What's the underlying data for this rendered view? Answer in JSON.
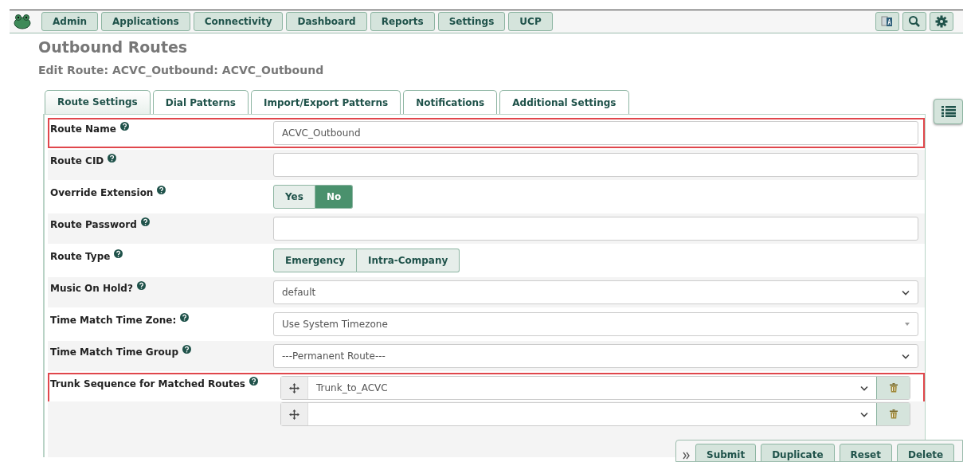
{
  "nav": {
    "items": [
      {
        "label": "Admin"
      },
      {
        "label": "Applications"
      },
      {
        "label": "Connectivity"
      },
      {
        "label": "Dashboard"
      },
      {
        "label": "Reports"
      },
      {
        "label": "Settings"
      },
      {
        "label": "UCP"
      }
    ]
  },
  "page": {
    "title": "Outbound Routes",
    "subtitle": "Edit Route: ACVC_Outbound: ACVC_Outbound"
  },
  "tabs": [
    {
      "label": "Route Settings",
      "selected": true
    },
    {
      "label": "Dial Patterns",
      "selected": false
    },
    {
      "label": "Import/Export Patterns",
      "selected": false
    },
    {
      "label": "Notifications",
      "selected": false
    },
    {
      "label": "Additional Settings",
      "selected": false
    }
  ],
  "fields": [
    {
      "kind": "text",
      "label": "Route Name",
      "value": "ACVC_Outbound",
      "highlighted": true
    },
    {
      "kind": "text",
      "label": "Route CID",
      "highlighted": false
    },
    {
      "kind": "toggle",
      "label": "Override Extension",
      "options": [
        {
          "label": "Yes",
          "selected": false
        },
        {
          "label": "No",
          "selected": true
        }
      ],
      "highlighted": false
    },
    {
      "kind": "text",
      "label": "Route Password",
      "highlighted": false
    },
    {
      "kind": "toggle",
      "label": "Route Type",
      "options": [
        {
          "label": "Emergency",
          "selected": false
        },
        {
          "label": "Intra-Company",
          "selected": false
        }
      ],
      "highlighted": false
    },
    {
      "kind": "select",
      "label": "Music On Hold?",
      "value": "default",
      "highlighted": false
    },
    {
      "kind": "combo",
      "label": "Time Match Time Zone:",
      "value": "Use System Timezone",
      "highlighted": false
    },
    {
      "kind": "select",
      "label": "Time Match Time Group",
      "value": "---Permanent Route---",
      "highlighted": false
    },
    {
      "kind": "trunks",
      "label": "Trunk Sequence for Matched Routes",
      "highlighted": true,
      "trunks": [
        {
          "kind": "filled",
          "value": "Trunk_to_ACVC"
        },
        {
          "kind": "blank"
        }
      ]
    }
  ],
  "actions": [
    {
      "label": "Submit"
    },
    {
      "label": "Duplicate"
    },
    {
      "label": "Reset"
    },
    {
      "label": "Delete"
    }
  ]
}
